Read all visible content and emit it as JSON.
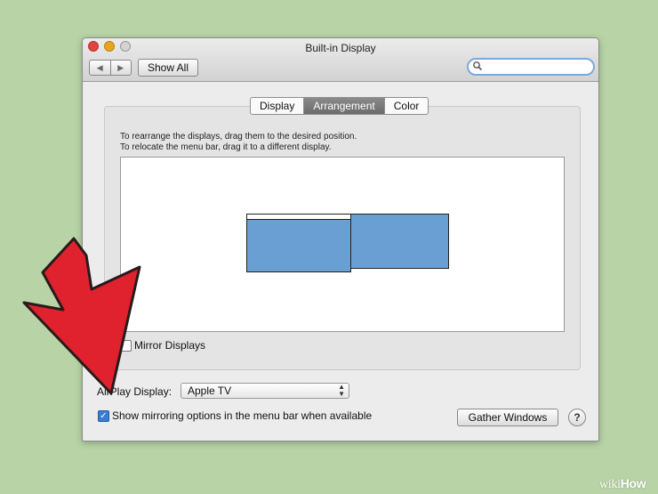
{
  "window": {
    "title": "Built-in Display",
    "back_glyph": "◀",
    "forward_glyph": "▶",
    "show_all_label": "Show All",
    "search_placeholder": ""
  },
  "tabs": [
    {
      "label": "Display",
      "active": false
    },
    {
      "label": "Arrangement",
      "active": true
    },
    {
      "label": "Color",
      "active": false
    }
  ],
  "arrangement": {
    "instruction_line1": "To rearrange the displays, drag them to the desired position.",
    "instruction_line2": "To relocate the menu bar, drag it to a different display.",
    "display_color": "#6a9fd4"
  },
  "mirror_displays": {
    "label": "Mirror Displays",
    "checked": false
  },
  "airplay": {
    "label": "AirPlay Display:",
    "selected": "Apple TV"
  },
  "show_mirroring": {
    "label": "Show mirroring options in the menu bar when available",
    "checked": true,
    "check_glyph": "✓"
  },
  "gather_windows_label": "Gather Windows",
  "help_label": "?",
  "overlay": {
    "arrow_color": "#e0222e",
    "arrow_icon": "down-left-arrow-icon"
  },
  "watermark": {
    "prefix": "wiki",
    "brand": "How"
  }
}
